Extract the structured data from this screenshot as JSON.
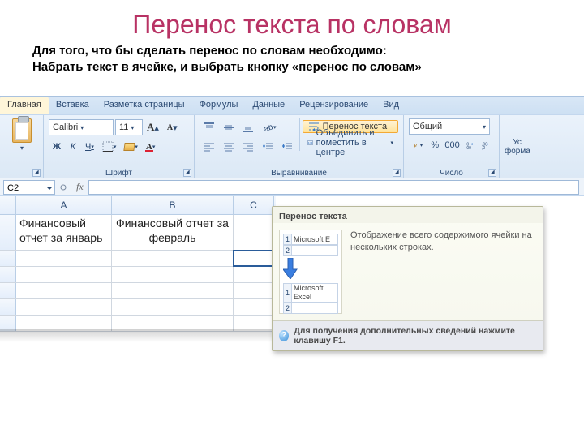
{
  "slide": {
    "title": "Перенос текста по словам",
    "desc_line1": "Для того, что бы сделать перенос по словам необходимо:",
    "desc_line2": "Набрать текст в ячейке, и выбрать кнопку «перенос по словам»"
  },
  "tabs": {
    "home": "Главная",
    "insert": "Вставка",
    "layout": "Разметка страницы",
    "formulas": "Формулы",
    "data": "Данные",
    "review": "Рецензирование",
    "view": "Вид"
  },
  "ribbon": {
    "font_name": "Calibri",
    "font_size": "11",
    "bold": "Ж",
    "italic": "К",
    "underline": "Ч",
    "grow": "A",
    "shrink": "A",
    "group_font": "Шрифт",
    "wrap_text": "Перенос текста",
    "merge_center": "Объединить и поместить в центре",
    "group_align": "Выравнивание",
    "number_format": "Общий",
    "group_number": "Число",
    "styles_hint": "Ус\nформа"
  },
  "formula_bar": {
    "name_box": "C2"
  },
  "columns": {
    "A": "A",
    "B": "B",
    "C": "C"
  },
  "cells": {
    "A1": "Финансовый отчет за январь",
    "B1": "Финансовый отчет за февраль"
  },
  "tooltip": {
    "title": "Перенос текста",
    "body": "Отображение всего содержимого ячейки на нескольких строках.",
    "illus_before": "Microsoft E",
    "illus_after": "Microsoft Excel",
    "r1": "1",
    "r2": "2",
    "footer": "Для получения дополнительных сведений нажмите клавишу F1."
  }
}
